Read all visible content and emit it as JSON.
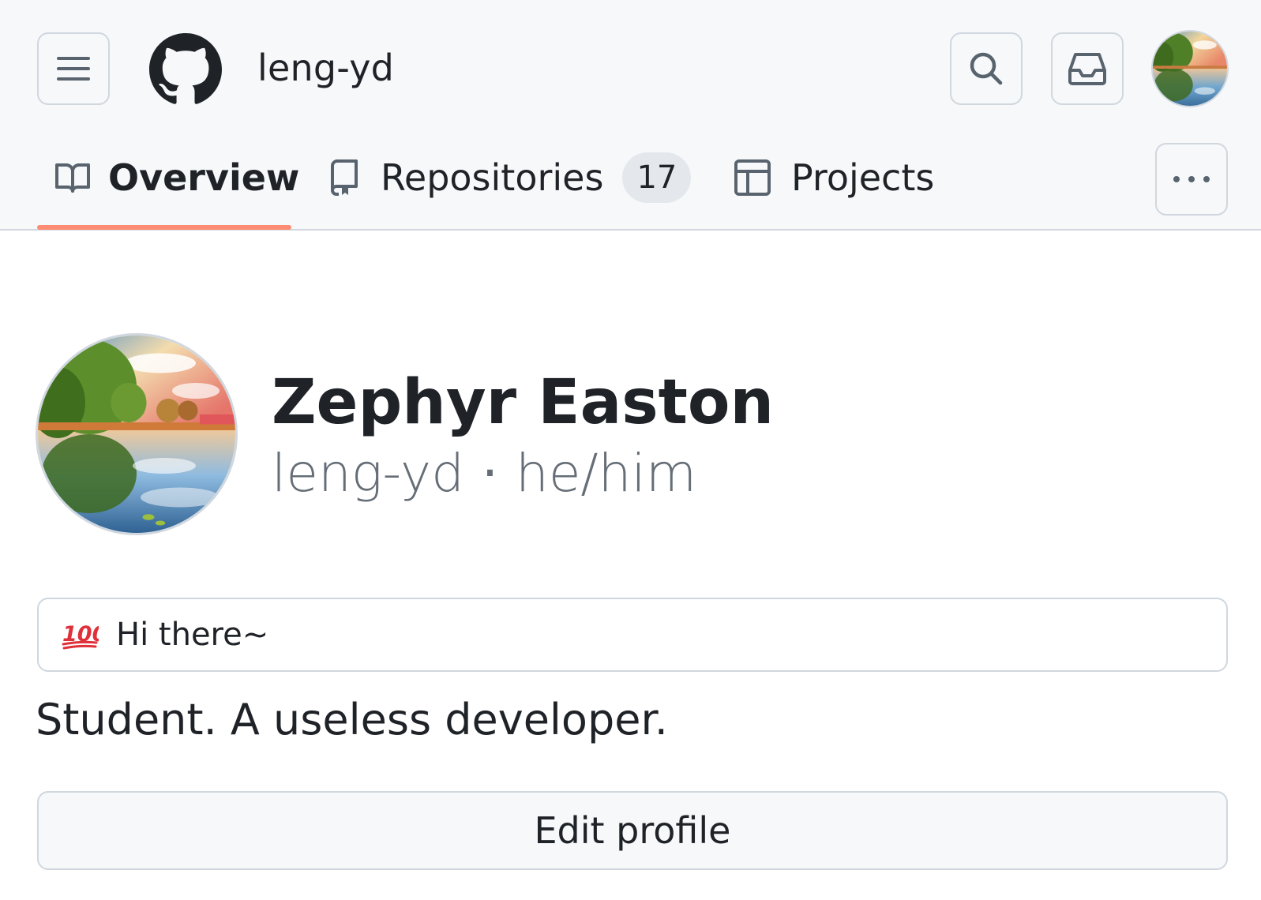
{
  "header": {
    "username": "leng-yd"
  },
  "tabs": [
    {
      "label": "Overview",
      "icon": "book-icon",
      "selected": true
    },
    {
      "label": "Repositories",
      "icon": "repo-icon",
      "count": "17"
    },
    {
      "label": "Projects",
      "icon": "table-icon"
    }
  ],
  "profile": {
    "name": "Zephyr Easton",
    "login": "leng-yd",
    "separator": "·",
    "pronouns": "he/him",
    "status": {
      "emoji": "hundred-points-icon",
      "text": "Hi there~"
    },
    "bio": "Student. A useless developer.",
    "edit_label": "Edit profile"
  },
  "colors": {
    "header_bg": "#f6f8fa",
    "border": "#d0d7de",
    "tab_underline": "#fd8c73",
    "muted_text": "#656d76",
    "text": "#1f2328"
  }
}
